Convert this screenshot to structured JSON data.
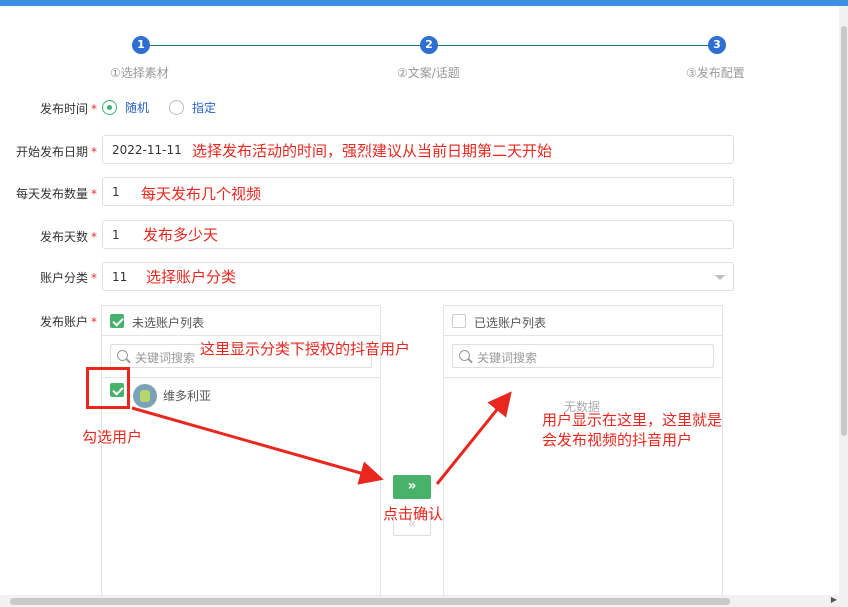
{
  "steps": [
    {
      "num": "1",
      "label": "①选择素材"
    },
    {
      "num": "2",
      "label": "②文案/话题"
    },
    {
      "num": "3",
      "label": "③发布配置"
    }
  ],
  "form": {
    "publish_time": {
      "label": "发布时间",
      "options": [
        "随机",
        "指定"
      ],
      "selected": "随机"
    },
    "start_date": {
      "label": "开始发布日期",
      "value": "2022-11-11"
    },
    "daily_count": {
      "label": "每天发布数量",
      "value": "1"
    },
    "days": {
      "label": "发布天数",
      "value": "1"
    },
    "account_category": {
      "label": "账户分类",
      "value": "11"
    },
    "accounts": {
      "label": "发布账户"
    }
  },
  "transfer": {
    "left": {
      "title": "未选账户列表",
      "placeholder": "关键词搜索",
      "items": [
        {
          "name": "维多利亚",
          "checked": true
        }
      ]
    },
    "right": {
      "title": "已选账户列表",
      "placeholder": "关键词搜索",
      "empty": "无数据"
    },
    "to_right": "»",
    "to_left": "«"
  },
  "annotations": {
    "date_hint": "选择发布活动的时间，强烈建议从当前日期第二天开始",
    "count_hint": "每天发布几个视频",
    "days_hint": "发布多少天",
    "category_hint": "选择账户分类",
    "list_hint": "这里显示分类下授权的抖音用户",
    "check_hint": "勾选用户",
    "confirm_hint": "点击确认",
    "right_hint_1": "用户显示在这里，这里就是",
    "right_hint_2": "会发布视频的抖音用户"
  },
  "colors": {
    "accent": "#3cb371",
    "primary": "#2f6fd1",
    "annotation": "#e8281e",
    "topbar": "#3d8fe5"
  },
  "required_mark": "*"
}
